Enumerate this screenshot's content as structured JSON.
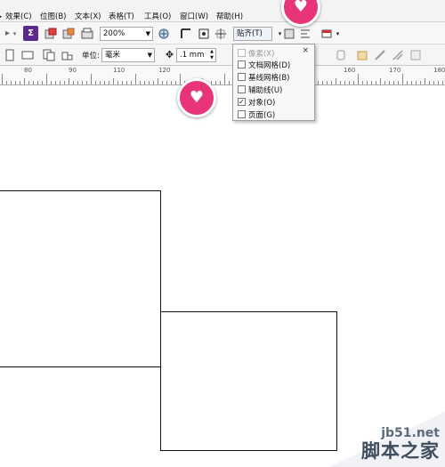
{
  "menu": {
    "items": [
      "效果(C)",
      "位图(B)",
      "文本(X)",
      "表格(T)",
      "工具(O)",
      "窗口(W)",
      "帮助(H)"
    ]
  },
  "toolbar": {
    "zoom_value": "200%",
    "snap_label": "贴齐(T)",
    "unit_label": "单位:",
    "unit_value": "毫米",
    "nudge_value": ".1 mm"
  },
  "ruler": {
    "labels": [
      "80",
      "90",
      "110",
      "120",
      "160",
      "170",
      "180"
    ]
  },
  "snap_menu": {
    "close": "×",
    "items": [
      {
        "label": "像素(X)",
        "checked": false,
        "enabled": false
      },
      {
        "label": "文档网格(D)",
        "checked": false,
        "enabled": true
      },
      {
        "label": "基线网格(B)",
        "checked": false,
        "enabled": true
      },
      {
        "label": "辅助线(U)",
        "checked": false,
        "enabled": true
      },
      {
        "label": "对象(O)",
        "checked": true,
        "enabled": true
      },
      {
        "label": "页面(G)",
        "checked": false,
        "enabled": true
      }
    ]
  },
  "watermark": {
    "url": "jb51.net",
    "name": "脚本之家"
  },
  "colors": {
    "marker": "#e8357a",
    "menubar": "#f3f3f3"
  }
}
